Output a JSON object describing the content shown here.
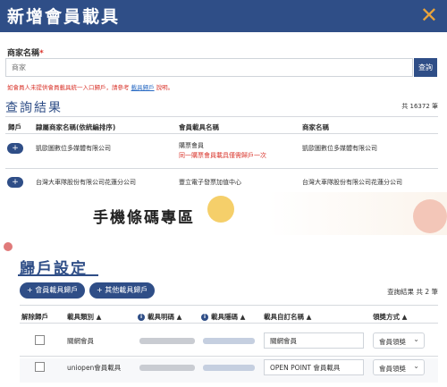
{
  "modal": {
    "title": "新增會員載具",
    "close": "✕"
  },
  "search": {
    "label": "商家名稱",
    "required": "*",
    "placeholder": "商家",
    "button": "查詢"
  },
  "hint": {
    "text": "如會員人未提供會員載具統一入口歸戶，請參考",
    "link": "載具歸戶",
    "suffix": "說明。"
  },
  "results": {
    "title": "查詢結果",
    "count": "共 16372 筆",
    "headers": [
      "歸戶",
      "隸屬商家名稱(依統編排序)",
      "會員載具名稱",
      "商家名稱"
    ],
    "rows": [
      {
        "plus": "+",
        "company": "凱歐圖數位多媒體有限公司",
        "carrier": "購票會員",
        "carrier_note": "同一購票會員載具僅需歸戶一次",
        "merchant": "凱歐圖數位多媒體有限公司"
      },
      {
        "plus": "+",
        "company": "台灣大車隊股份有限公司花蓮分公司",
        "carrier": "豐立電子發票加值中心",
        "merchant": "台灣大車隊股份有限公司花蓮分公司"
      }
    ]
  },
  "banner": {
    "title": "手機條碼專區"
  },
  "binding": {
    "title": "歸戶設定",
    "add_member_button": "+ 會員載具歸戶",
    "add_other_button": "+ 其他載具歸戶",
    "count": "查詢結果 共 2 筆",
    "headers": {
      "unbind": "解除歸戶",
      "type": "載具類別",
      "visible_code": "載具明碼",
      "hidden_code": "載具隱碼",
      "nickname": "載具自訂名稱",
      "award": "領獎方式"
    },
    "rows": [
      {
        "type": "關網會員",
        "nickname": "關網會員",
        "award": "會員領獎"
      },
      {
        "type": "uniopen會員載具",
        "nickname": "OPEN POINT 會員載具",
        "award": "會員領獎"
      }
    ]
  },
  "colors": {
    "primary": "#2f4e87",
    "accent": "#e8a33c",
    "danger": "#d9342b"
  }
}
